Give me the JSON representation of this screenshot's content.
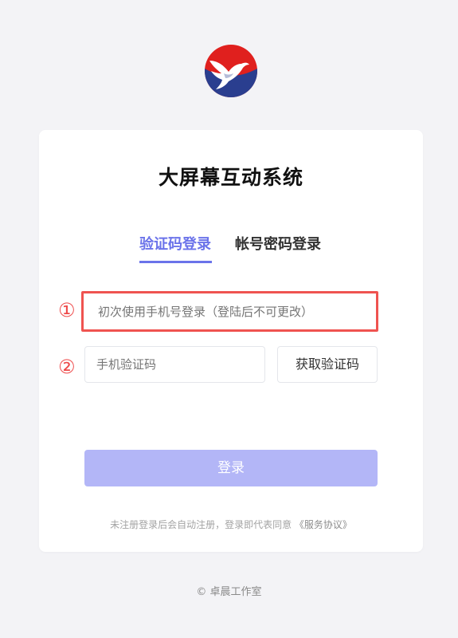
{
  "app": {
    "logo_icon": "eagle-logo-icon",
    "title": "大屏幕互动系统"
  },
  "tabs": [
    {
      "label": "验证码登录",
      "active": true
    },
    {
      "label": "帐号密码登录",
      "active": false
    }
  ],
  "markers": {
    "one": "①",
    "two": "②"
  },
  "form": {
    "phone_placeholder": "初次使用手机号登录（登陆后不可更改）",
    "code_placeholder": "手机验证码",
    "get_code_label": "获取验证码",
    "login_label": "登录"
  },
  "agreement": {
    "text": "未注册登录后会自动注册，登录即代表同意",
    "link": "《服务协议》"
  },
  "footer": {
    "copyright": "© 卓晨工作室"
  },
  "colors": {
    "accent": "#6b73ea",
    "button_disabled": "#b3b6f7",
    "highlight_border": "#ef5350",
    "logo_red": "#e0201e",
    "logo_blue": "#2a3e8f"
  }
}
